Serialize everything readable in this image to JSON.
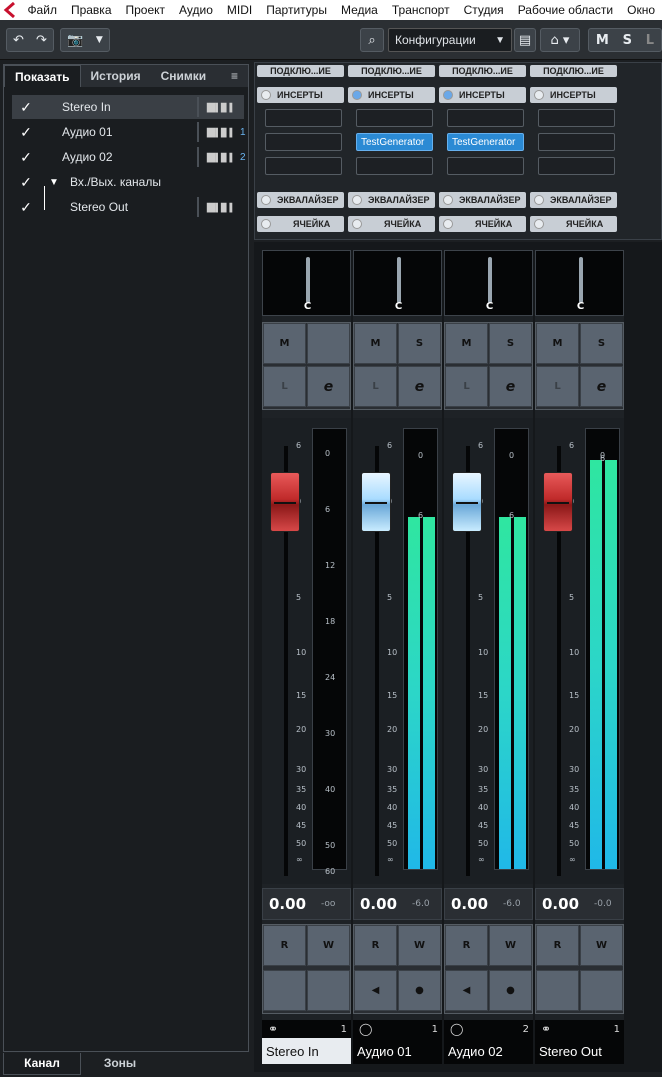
{
  "menu": [
    "Файл",
    "Правка",
    "Проект",
    "Аудио",
    "MIDI",
    "Партитуры",
    "Медиа",
    "Транспорт",
    "Студия",
    "Рабочие области",
    "Окно"
  ],
  "toolbar": {
    "config": "Конфигурации",
    "m": "M",
    "s": "S",
    "l": "L"
  },
  "left": {
    "tabs": [
      "Показать",
      "История",
      "Снимки"
    ],
    "menu_icon": "≡",
    "items": [
      {
        "label": "Stereo In",
        "num": "",
        "wave": true,
        "selected": true
      },
      {
        "label": "Аудио 01",
        "num": "1",
        "wave": true
      },
      {
        "label": "Аудио 02",
        "num": "2",
        "wave": true
      },
      {
        "label": "Вх./Вых. каналы",
        "num": "",
        "wave": false,
        "folder": true
      },
      {
        "label": "Stereo Out",
        "num": "",
        "wave": true,
        "child": true
      }
    ],
    "bottom_tabs": [
      "Канал",
      "Зоны"
    ]
  },
  "rack": {
    "routing": "ПОДКЛЮ...ИЕ",
    "inserts": "ИНСЕРТЫ",
    "eq": "ЭКВАЛАЙЗЕР",
    "cell": "ЯЧЕЙКА",
    "insert_plugin": "TestGenerator"
  },
  "strips": [
    {
      "name": "Stereo In",
      "num": "1",
      "value": "0.00",
      "peak": "-oo",
      "fader": 0.0,
      "color": "red",
      "pan": "C",
      "meter": 0,
      "m": "M",
      "s": "",
      "l": "L",
      "e": "e",
      "r": "R",
      "w": "W",
      "selected": true
    },
    {
      "name": "Аудио 01",
      "num": "1",
      "value": "0.00",
      "peak": "-6.0",
      "fader": 0.0,
      "color": "blue",
      "pan": "C",
      "meter": 0.8,
      "m": "M",
      "s": "S",
      "l": "L",
      "e": "e",
      "r": "R",
      "w": "W"
    },
    {
      "name": "Аудио 02",
      "num": "2",
      "value": "0.00",
      "peak": "-6.0",
      "fader": 0.0,
      "color": "blue",
      "pan": "C",
      "meter": 0.8,
      "m": "M",
      "s": "S",
      "l": "L",
      "e": "e",
      "r": "R",
      "w": "W"
    },
    {
      "name": "Stereo Out",
      "num": "1",
      "value": "0.00",
      "peak": "-0.0",
      "fader": 0.0,
      "color": "red",
      "pan": "C",
      "meter": 0.93,
      "m": "M",
      "s": "S",
      "l": "L",
      "e": "e",
      "r": "R",
      "w": "W"
    }
  ],
  "fader_scale": [
    "6",
    "0",
    "5",
    "10",
    "15",
    "20",
    "30",
    "35",
    "40",
    "45",
    "50",
    "∞"
  ],
  "meter_scale": [
    "0",
    "6",
    "12",
    "18",
    "24",
    "30",
    "40",
    "50",
    "60"
  ],
  "meter_scale_short": [
    "0",
    "6"
  ]
}
